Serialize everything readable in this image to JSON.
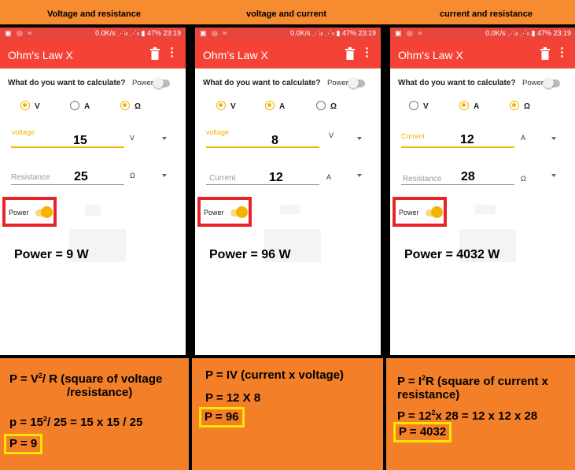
{
  "headers": [
    "Voltage and resistance",
    "voltage and current",
    "current and resistance"
  ],
  "status": {
    "left": "▣ ◎ ≈",
    "right": "0.0K/s ⋰ᵢₗₗ ⋰ₗₗ ▮ 47% 23:19"
  },
  "app": {
    "title": "Ohm's Law X",
    "question": "What do you want to calculate?",
    "power_switch_label": "Power",
    "radio_labels": [
      "V",
      "A",
      "Ω"
    ],
    "toggle_label": "Power"
  },
  "phones": [
    {
      "field1": {
        "label": "voltage",
        "value": "15",
        "unit": "V"
      },
      "field2": {
        "label": "Resistance",
        "value": "25",
        "unit": "Ω"
      },
      "result": "Power = 9 W"
    },
    {
      "field1": {
        "label": "voltage",
        "value": "8",
        "unit": "V"
      },
      "field2": {
        "label": "Current",
        "value": "12",
        "unit": "A"
      },
      "result": "Power = 96 W"
    },
    {
      "field1": {
        "label": "Current",
        "value": "12",
        "unit": "A"
      },
      "field2": {
        "label": "Resistance",
        "value": "28",
        "unit": "Ω"
      },
      "result": "Power = 4032 W"
    }
  ],
  "formulas": {
    "p1": {
      "line1_a": "P = V",
      "line1_sup": "2",
      "line1_b": "/ R  (square of voltage",
      "line2": "/resistance)",
      "line3_a": "p = 15",
      "line3_sup": "2",
      "line3_b": "/ 25  = 15 x 15 / 25",
      "answer": "P = 9"
    },
    "p2": {
      "line1": "P = IV (current x voltage)",
      "line2": "P = 12 X 8",
      "answer": "P = 96"
    },
    "p3": {
      "line1_a": "P = I",
      "line1_sup": "2",
      "line1_b": "R (square of current x",
      "line2": "resistance)",
      "line3_a": "P = 12",
      "line3_sup": "2",
      "line3_b": "x 28 = 12 x 12 x 28",
      "answer": "P = 4032"
    }
  }
}
